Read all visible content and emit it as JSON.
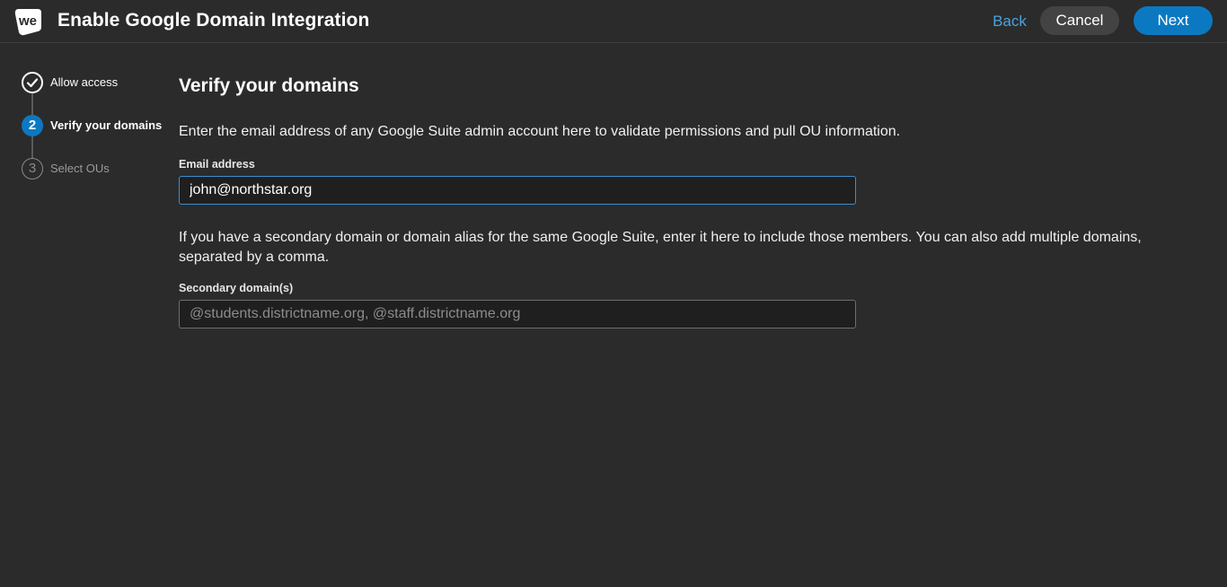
{
  "header": {
    "title": "Enable Google Domain Integration",
    "logo_text": "we",
    "back_label": "Back",
    "cancel_label": "Cancel",
    "next_label": "Next",
    "accent_color": "#0b79c2",
    "link_color": "#4aa3df"
  },
  "stepper": {
    "steps": [
      {
        "number": "✓",
        "label": "Allow access",
        "state": "done",
        "icon": "checkmark-icon"
      },
      {
        "number": "2",
        "label": "Verify your domains",
        "state": "active"
      },
      {
        "number": "3",
        "label": "Select OUs",
        "state": "pending"
      }
    ]
  },
  "main": {
    "title": "Verify your domains",
    "email_description": "Enter the email address of any Google Suite admin account here to validate permissions and pull OU information.",
    "email_label": "Email address",
    "email_value": "john@northstar.org",
    "secondary_description": "If you have a secondary domain or domain alias for the same Google Suite, enter it here to include those members. You can also add multiple domains, separated by a comma.",
    "secondary_label": "Secondary domain(s)",
    "secondary_value": "",
    "secondary_placeholder": "@students.districtname.org, @staff.districtname.org"
  }
}
